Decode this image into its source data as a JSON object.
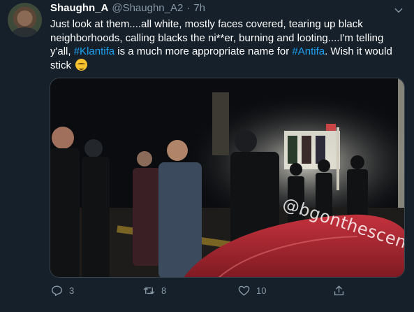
{
  "tweet": {
    "display_name": "Shaughn_A",
    "handle": "@Shaughn_A2",
    "separator": "·",
    "time": "7h",
    "text_part1": "Just look at them....all white, mostly faces covered, tearing up black neighborhoods, calling blacks the ni**er, burning and looting....I'm telling y'all, ",
    "hashtag1": "#Klantifa",
    "text_part2": " is a much more appropriate name for ",
    "hashtag2": "#Antifa",
    "text_part3": ". Wish it would stick",
    "emoji": "pensive-face-emoji"
  },
  "media": {
    "watermark": "@bgonthescene"
  },
  "actions": {
    "reply_count": "3",
    "retweet_count": "8",
    "like_count": "10"
  },
  "colors": {
    "background": "#15202b",
    "text": "#ffffff",
    "secondary": "#8899a6",
    "link": "#1da1f2",
    "border": "#38444d"
  },
  "icons": {
    "caret": "chevron-down-icon",
    "reply": "reply-icon",
    "retweet": "retweet-icon",
    "like": "heart-icon",
    "share": "share-icon"
  }
}
